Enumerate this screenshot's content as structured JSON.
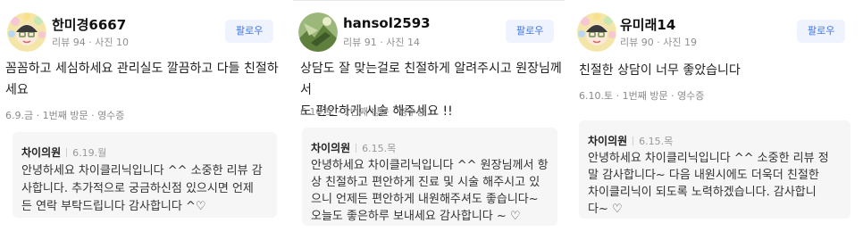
{
  "reviews": [
    {
      "nickname": "한미경6667",
      "stats": "리뷰 94 · 사진 10",
      "follow_label": "팔로우",
      "text_lines": [
        "꼼꼼하고 세심하세요 관리실도 깔끔하고 다들 친절하",
        "세요"
      ],
      "visit": "6.9.금 · 1번째 방문 · 영수증",
      "reply": {
        "name": "차이의원",
        "date": "6.19.월",
        "lines": [
          "안녕하세요 차이클리닉입니다 ^^ 소중한 리뷰 감",
          "사합니다. 추가적으로 궁금하신점 있으시면 언제",
          "든 연락 부탁드립니다 감사합니다 ^♡"
        ]
      },
      "avatar_icon": "cartoon-face-flower-wreath"
    },
    {
      "nickname": "hansol2593",
      "stats": "리뷰 91 · 사진 14",
      "follow_label": "팔로우",
      "text_lines": [
        "상담도 잘 맞는걸로 친절하게 알려주시고 원장님께서",
        "도 편안하게 시술 해주세요 !!"
      ],
      "visit": "6.10.토 · 1번째 방문 · 영수증",
      "reply": {
        "name": "차이의원",
        "date": "6.15.목",
        "lines": [
          "안녕하세요 차이클리닉입니다 ^^ 원장님께서 항",
          "상 친절하고 편안하게 진료 및 시술 해주시고 있",
          "으니 언제든 편안하게 내원해주셔도 좋습니다~",
          "오늘도 좋은하루 보내세요 감사합니다 ~ ♡"
        ]
      },
      "avatar_icon": "nature-photo"
    },
    {
      "nickname": "유미래14",
      "stats": "리뷰 90 · 사진 19",
      "follow_label": "팔로우",
      "text_lines": [
        "친절한 상담이 너무 좋았습니다"
      ],
      "visit": "6.10.토 · 1번째 방문 · 영수증",
      "reply": {
        "name": "차이의원",
        "date": "6.15.목",
        "lines": [
          "안녕하세요 차이클리닉입니다 ^^ 소중한 리뷰 정",
          "말 감사합니다~ 다음 내원시에도 더욱더 친절한",
          "차이클리닉이 되도록 노력하겠습니다. 감사합니",
          "다~ ♡"
        ]
      },
      "avatar_icon": "cartoon-face-flower-wreath"
    }
  ],
  "colors": {
    "follow_bg": "#eef3fd",
    "follow_text": "#4176e7",
    "reply_bg": "#f6f6f6"
  }
}
